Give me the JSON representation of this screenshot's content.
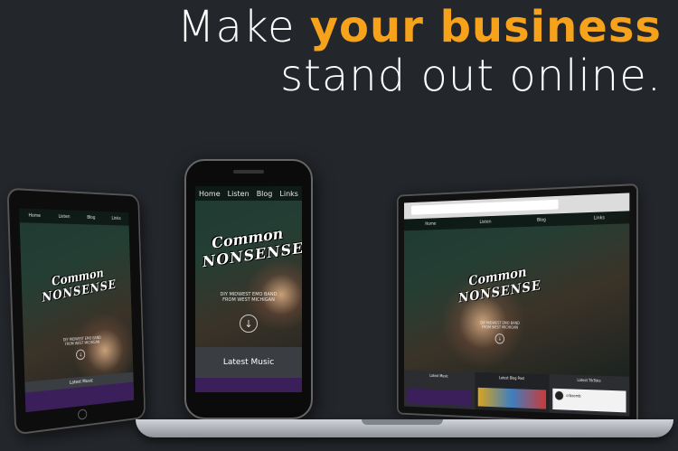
{
  "colors": {
    "accent": "#f7a21b",
    "background": "#23262b"
  },
  "headline": {
    "line1_prefix": "Make ",
    "line1_accent": "your business",
    "line2": "stand out online."
  },
  "nav": {
    "home": "Home",
    "listen": "Listen",
    "blog": "Blog",
    "links": "Links"
  },
  "band": {
    "logo_top": "Common",
    "logo_bottom": "NONSENSE",
    "tagline_line1": "DIY MIDWEST EMO BAND",
    "tagline_line2": "FROM WEST MICHIGAN"
  },
  "sections": {
    "latest_music": "Latest Music",
    "latest_blog_post": "Latest Blog Post",
    "latest_tiktoks": "Latest TikToks",
    "tiktok_user": "crboomb"
  },
  "icons": {
    "scroll_down": "arrow-down-circle-icon"
  }
}
